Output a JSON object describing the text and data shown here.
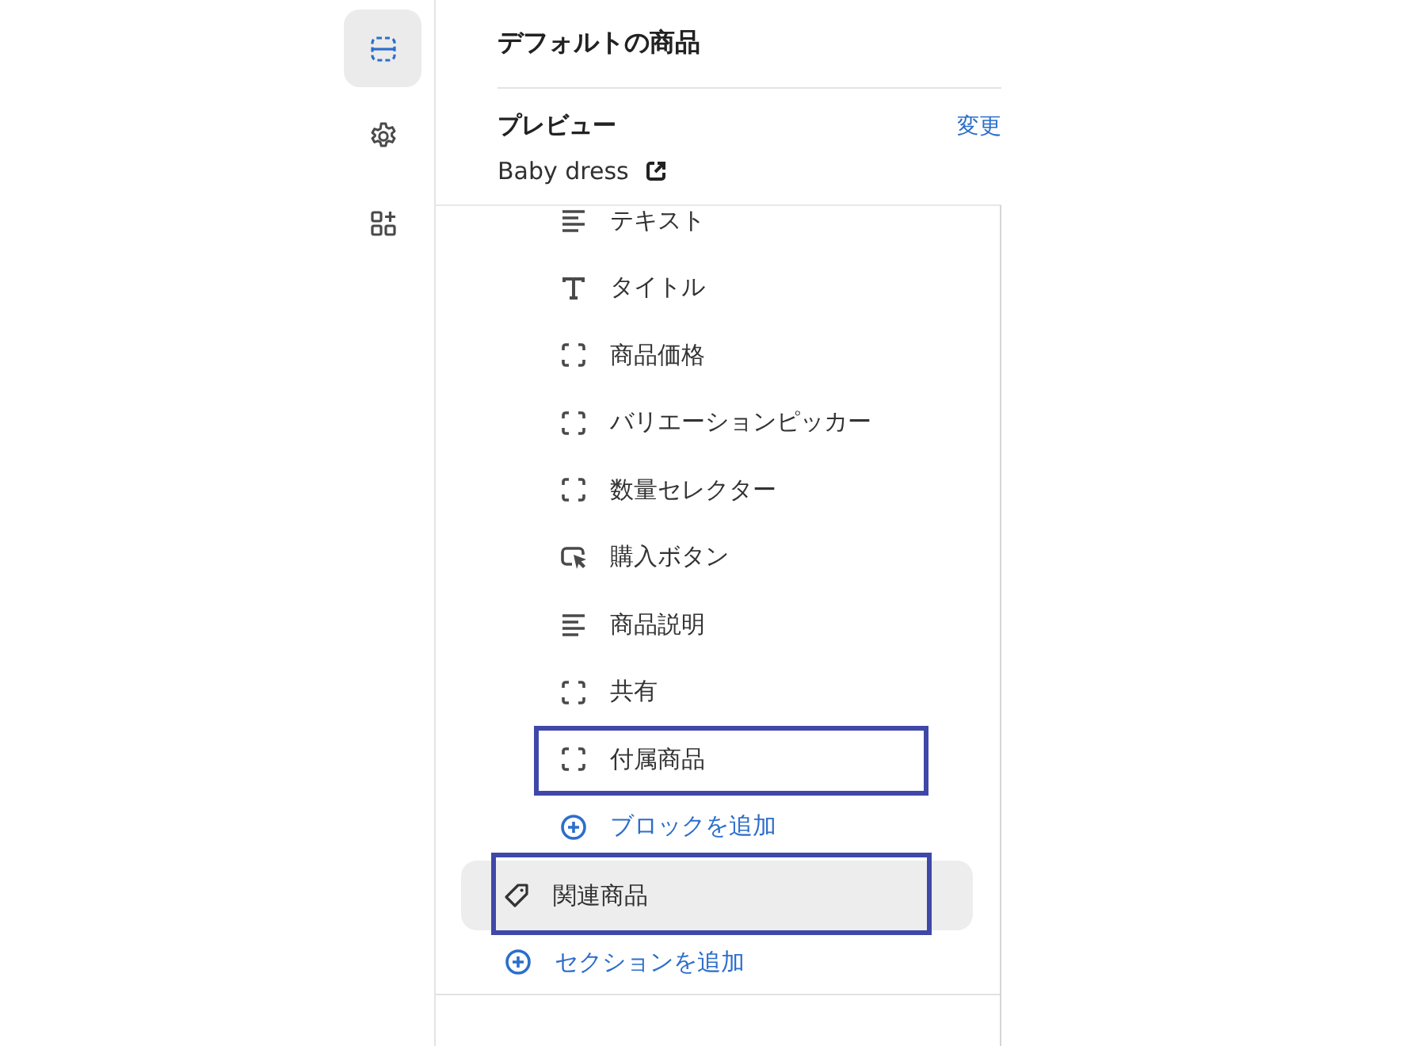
{
  "rail": [
    {
      "kind": "sections",
      "selected": true
    },
    {
      "kind": "settings",
      "selected": false
    },
    {
      "kind": "apps",
      "selected": false
    }
  ],
  "header": {
    "title": "デフォルトの商品"
  },
  "preview": {
    "title": "プレビュー",
    "change": "変更",
    "product": "Baby dress"
  },
  "blocks": [
    {
      "kind": "lines",
      "label": "テキスト",
      "annotated": false
    },
    {
      "kind": "title",
      "label": "タイトル",
      "annotated": false
    },
    {
      "kind": "block",
      "label": "商品価格",
      "annotated": false
    },
    {
      "kind": "block",
      "label": "バリエーションピッカー",
      "annotated": false
    },
    {
      "kind": "block",
      "label": "数量セレクター",
      "annotated": false
    },
    {
      "kind": "cursor",
      "label": "購入ボタン",
      "annotated": false
    },
    {
      "kind": "lines",
      "label": "商品説明",
      "annotated": false
    },
    {
      "kind": "block",
      "label": "共有",
      "annotated": false
    },
    {
      "kind": "block",
      "label": "付属商品",
      "annotated": true
    }
  ],
  "add_block": "ブロックを追加",
  "section": {
    "label": "関連商品",
    "selected": true,
    "annotated": true
  },
  "add_section": "セクションを追加"
}
